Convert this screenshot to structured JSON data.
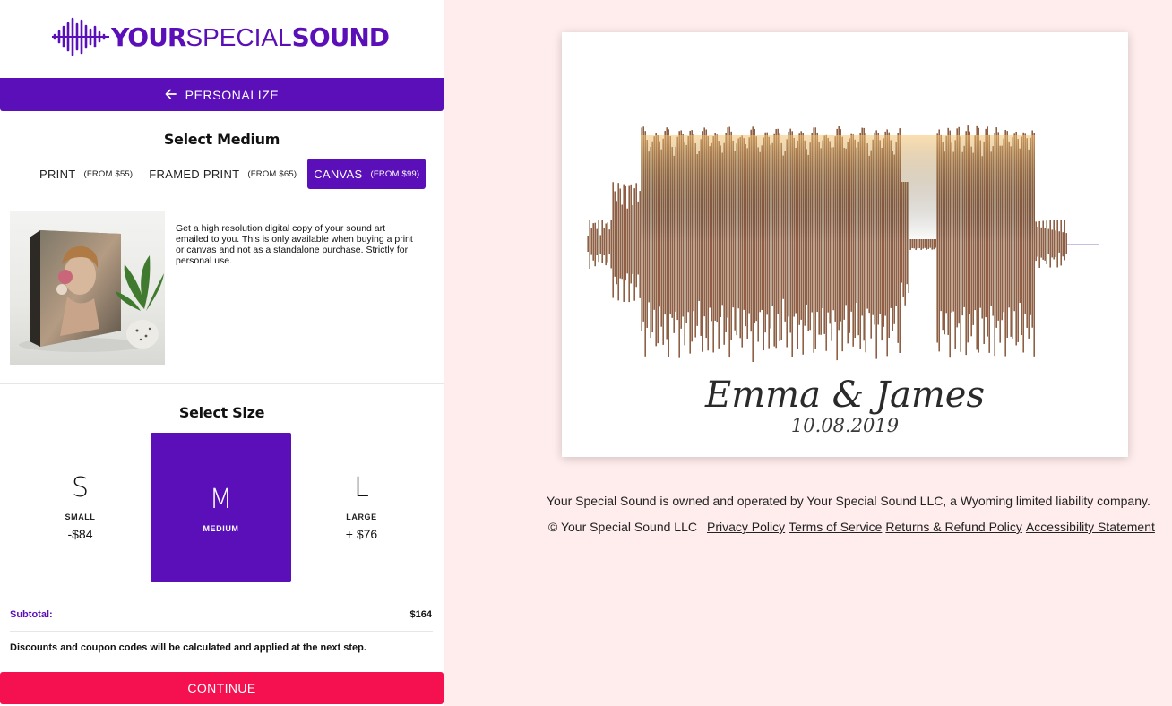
{
  "brand": {
    "logo_text_your": "YOUR",
    "logo_text_special": "SPECIAL",
    "logo_text_sound": "SOUND",
    "primary_color": "#5a0fb8",
    "accent_color": "#f5114f"
  },
  "nav": {
    "back_label": "PERSONALIZE",
    "back_icon": "arrow-left-icon"
  },
  "medium": {
    "title": "Select Medium",
    "options": [
      {
        "label": "PRINT",
        "price": "(FROM $55)",
        "selected": false
      },
      {
        "label": "FRAMED PRINT",
        "price": "(FROM $65)",
        "selected": false
      },
      {
        "label": "CANVAS",
        "price": "(FROM $99)",
        "selected": true
      }
    ],
    "description": "Get a high resolution digital copy of your sound art emailed to you. This is only available when buying a print or canvas and not as a standalone purchase. Strictly for personal use."
  },
  "size": {
    "title": "Select Size",
    "options": [
      {
        "letter": "S",
        "label": "SMALL",
        "price": "-$84",
        "selected": false
      },
      {
        "letter": "M",
        "label": "MEDIUM",
        "price": "",
        "selected": true
      },
      {
        "letter": "L",
        "label": "LARGE",
        "price": "+ $76",
        "selected": false
      }
    ]
  },
  "summary": {
    "subtotal_label": "Subtotal:",
    "subtotal_value": "$164",
    "note": "Discounts and coupon codes will be calculated and applied at the next step."
  },
  "cta": {
    "continue_label": "CONTINUE"
  },
  "preview": {
    "names": "Emma & James",
    "date": "10.08.2019"
  },
  "footer": {
    "owned_text": "Your Special Sound is owned and operated by Your Special Sound LLC, a Wyoming limited liability company.",
    "copyright": "© Your Special Sound LLC",
    "links": [
      "Privacy Policy",
      "Terms of Service",
      "Returns & Refund Policy",
      "Accessibility Statement"
    ]
  }
}
